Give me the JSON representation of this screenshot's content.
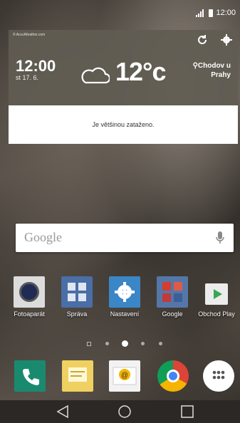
{
  "status_bar": {
    "clock": "12:00"
  },
  "weather_widget": {
    "source": "© AccuWeather.com",
    "time": "12:00",
    "date": "st 17. 6.",
    "temperature": "12°c",
    "location": "Chodov u Prahy",
    "condition": "Je většinou zataženo."
  },
  "search": {
    "logo": "Google"
  },
  "apps": [
    {
      "label": "Fotoaparát",
      "icon": "camera-icon"
    },
    {
      "label": "Správa",
      "icon": "management-icon"
    },
    {
      "label": "Nastavení",
      "icon": "settings-icon"
    },
    {
      "label": "Google",
      "icon": "google-folder-icon"
    },
    {
      "label": "Obchod Play",
      "icon": "play-store-icon"
    }
  ],
  "dock": [
    {
      "icon": "phone-icon"
    },
    {
      "icon": "messages-icon"
    },
    {
      "icon": "email-icon"
    },
    {
      "icon": "chrome-icon"
    },
    {
      "icon": "app-drawer-icon"
    }
  ],
  "nav": [
    "back-icon",
    "home-icon",
    "recents-icon"
  ],
  "colors": {
    "widget_bg": "#615c52",
    "phone": "#1a8a6e",
    "settings": "#3b86c6"
  }
}
